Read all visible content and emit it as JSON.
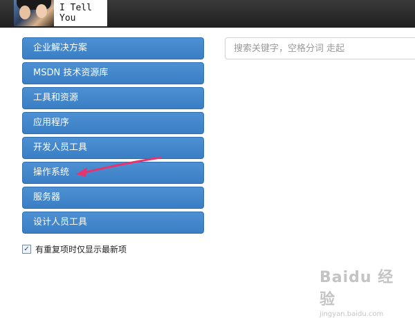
{
  "header": {
    "brand_text": "I Tell You"
  },
  "sidebar": {
    "items": [
      {
        "label": "企业解决方案"
      },
      {
        "label": "MSDN 技术资源库"
      },
      {
        "label": "工具和资源"
      },
      {
        "label": "应用程序"
      },
      {
        "label": "开发人员工具"
      },
      {
        "label": "操作系统"
      },
      {
        "label": "服务器"
      },
      {
        "label": "设计人员工具"
      }
    ]
  },
  "search": {
    "placeholder": "搜索关键字，空格分词 走起"
  },
  "options": {
    "dedupe_label": "有重复项时仅显示最新项",
    "dedupe_checked": true
  },
  "watermark": {
    "logo_text": "Baidu 经验",
    "url_text": "jingyan.baidu.com"
  },
  "colors": {
    "nav_button": "#4289cc",
    "annotation_arrow": "#e8336e",
    "topbar": "#2a2a2a"
  }
}
